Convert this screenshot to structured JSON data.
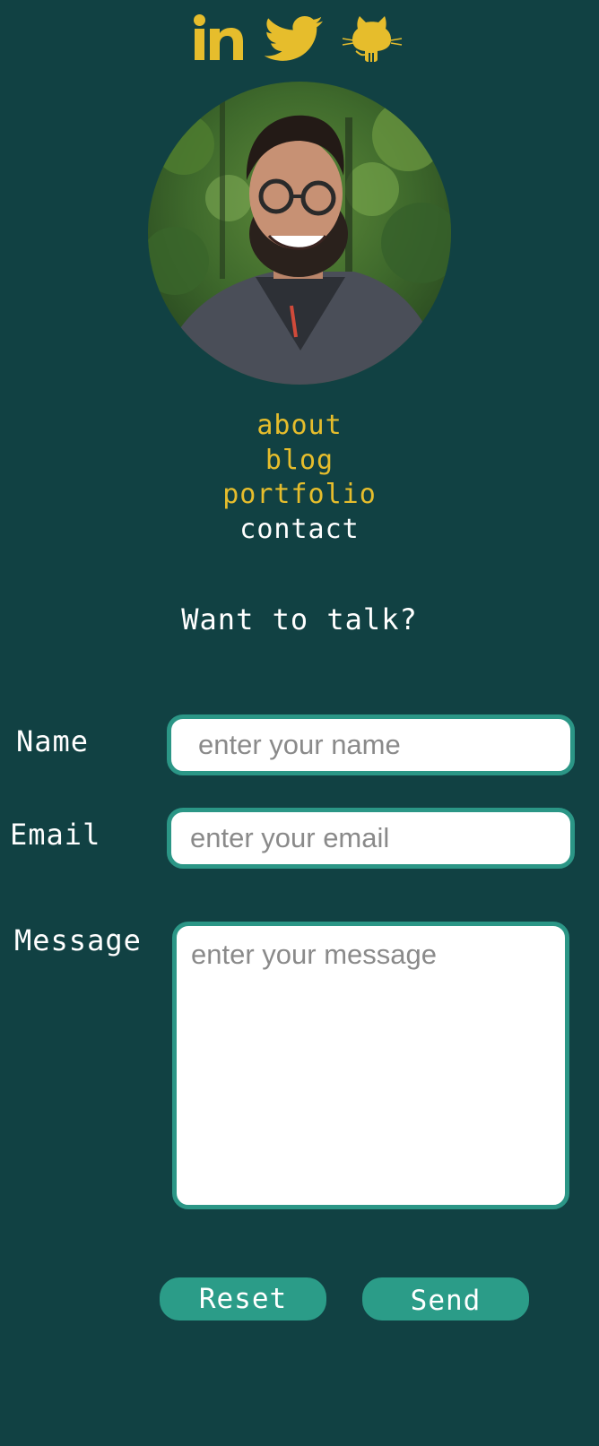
{
  "social": {
    "icons": [
      "linkedin-icon",
      "twitter-icon",
      "github-icon"
    ]
  },
  "nav": {
    "items": [
      "about",
      "blog",
      "portfolio",
      "contact"
    ],
    "active": "contact"
  },
  "contact": {
    "heading": "Want to talk?",
    "name": {
      "label": "Name",
      "placeholder": "enter your name",
      "value": ""
    },
    "email": {
      "label": "Email",
      "placeholder": "enter your email",
      "value": ""
    },
    "message": {
      "label": "Message",
      "placeholder": "enter your message",
      "value": ""
    },
    "reset_label": "Reset",
    "send_label": "Send"
  },
  "colors": {
    "background": "#114143",
    "accent": "#e6bd2c",
    "button": "#2b9c88",
    "field_border": "#2b9686"
  }
}
